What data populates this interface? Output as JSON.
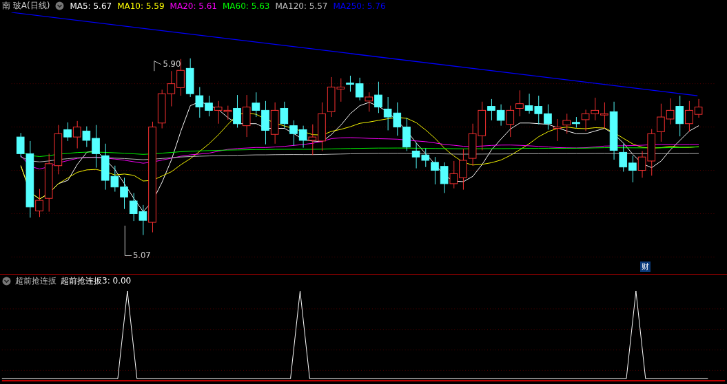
{
  "stock_title": "南 玻A(日线)",
  "moving_averages": [
    {
      "label": "MA5: 5.67",
      "color": "#ffffff"
    },
    {
      "label": "MA10: 5.59",
      "color": "#ffff00"
    },
    {
      "label": "MA20: 5.61",
      "color": "#ff00ff"
    },
    {
      "label": "MA60: 5.63",
      "color": "#00ff00"
    },
    {
      "label": "MA120: 5.57",
      "color": "#c0c0c0"
    },
    {
      "label": "MA250: 5.76",
      "color": "#0000ff"
    }
  ],
  "price_chart": {
    "high_label": "5.90",
    "low_label": "5.07",
    "finance_badge": "财"
  },
  "indicator": {
    "name": "超前抢连扳",
    "value_label": "超前抢连扳3: 0.00"
  }
}
